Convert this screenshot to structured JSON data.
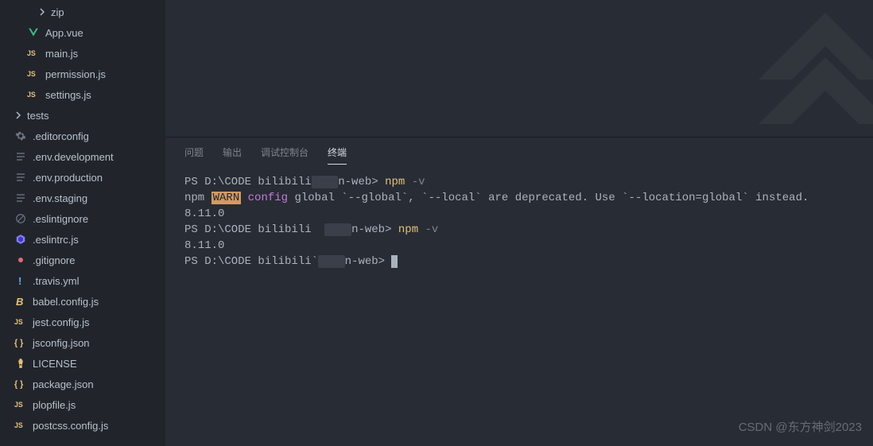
{
  "sidebar": {
    "items": [
      {
        "name": "zip",
        "icon": "chevron-right",
        "indent": 2
      },
      {
        "name": "App.vue",
        "icon": "vue",
        "indent": 1
      },
      {
        "name": "main.js",
        "icon": "js",
        "indent": 1
      },
      {
        "name": "permission.js",
        "icon": "js",
        "indent": 1
      },
      {
        "name": "settings.js",
        "icon": "js",
        "indent": 1
      },
      {
        "name": "tests",
        "icon": "chevron-right",
        "indent": 0
      },
      {
        "name": ".editorconfig",
        "icon": "gear",
        "indent": 0
      },
      {
        "name": ".env.development",
        "icon": "lines",
        "indent": 0
      },
      {
        "name": ".env.production",
        "icon": "lines",
        "indent": 0
      },
      {
        "name": ".env.staging",
        "icon": "lines",
        "indent": 0
      },
      {
        "name": ".eslintignore",
        "icon": "eslint-gray",
        "indent": 0
      },
      {
        "name": ".eslintrc.js",
        "icon": "eslint",
        "indent": 0
      },
      {
        "name": ".gitignore",
        "icon": "git",
        "indent": 0
      },
      {
        "name": ".travis.yml",
        "icon": "excl",
        "indent": 0
      },
      {
        "name": "babel.config.js",
        "icon": "babel",
        "indent": 0
      },
      {
        "name": "jest.config.js",
        "icon": "js",
        "indent": 0
      },
      {
        "name": "jsconfig.json",
        "icon": "brace",
        "indent": 0
      },
      {
        "name": "LICENSE",
        "icon": "license",
        "indent": 0
      },
      {
        "name": "package.json",
        "icon": "brace",
        "indent": 0
      },
      {
        "name": "plopfile.js",
        "icon": "js",
        "indent": 0
      },
      {
        "name": "postcss.config.js",
        "icon": "js",
        "indent": 0
      }
    ]
  },
  "panel": {
    "tabs": [
      {
        "label": "问题",
        "active": false
      },
      {
        "label": "输出",
        "active": false
      },
      {
        "label": "调试控制台",
        "active": false
      },
      {
        "label": "终端",
        "active": true
      }
    ]
  },
  "terminal": {
    "prompt_prefix": "PS D:\\CODE bilibili",
    "prompt_redacted": "    ",
    "prompt_suffix": "n-web>",
    "cmd_npm": "npm",
    "cmd_flag": "-v",
    "warn_npm": "npm",
    "warn_label": "WARN",
    "warn_config": "config",
    "warn_rest": " global `--global`, `--local` are deprecated. Use `--location=global` instead.",
    "version": "8.11.0"
  },
  "watermark": "CSDN @东方神剑2023"
}
